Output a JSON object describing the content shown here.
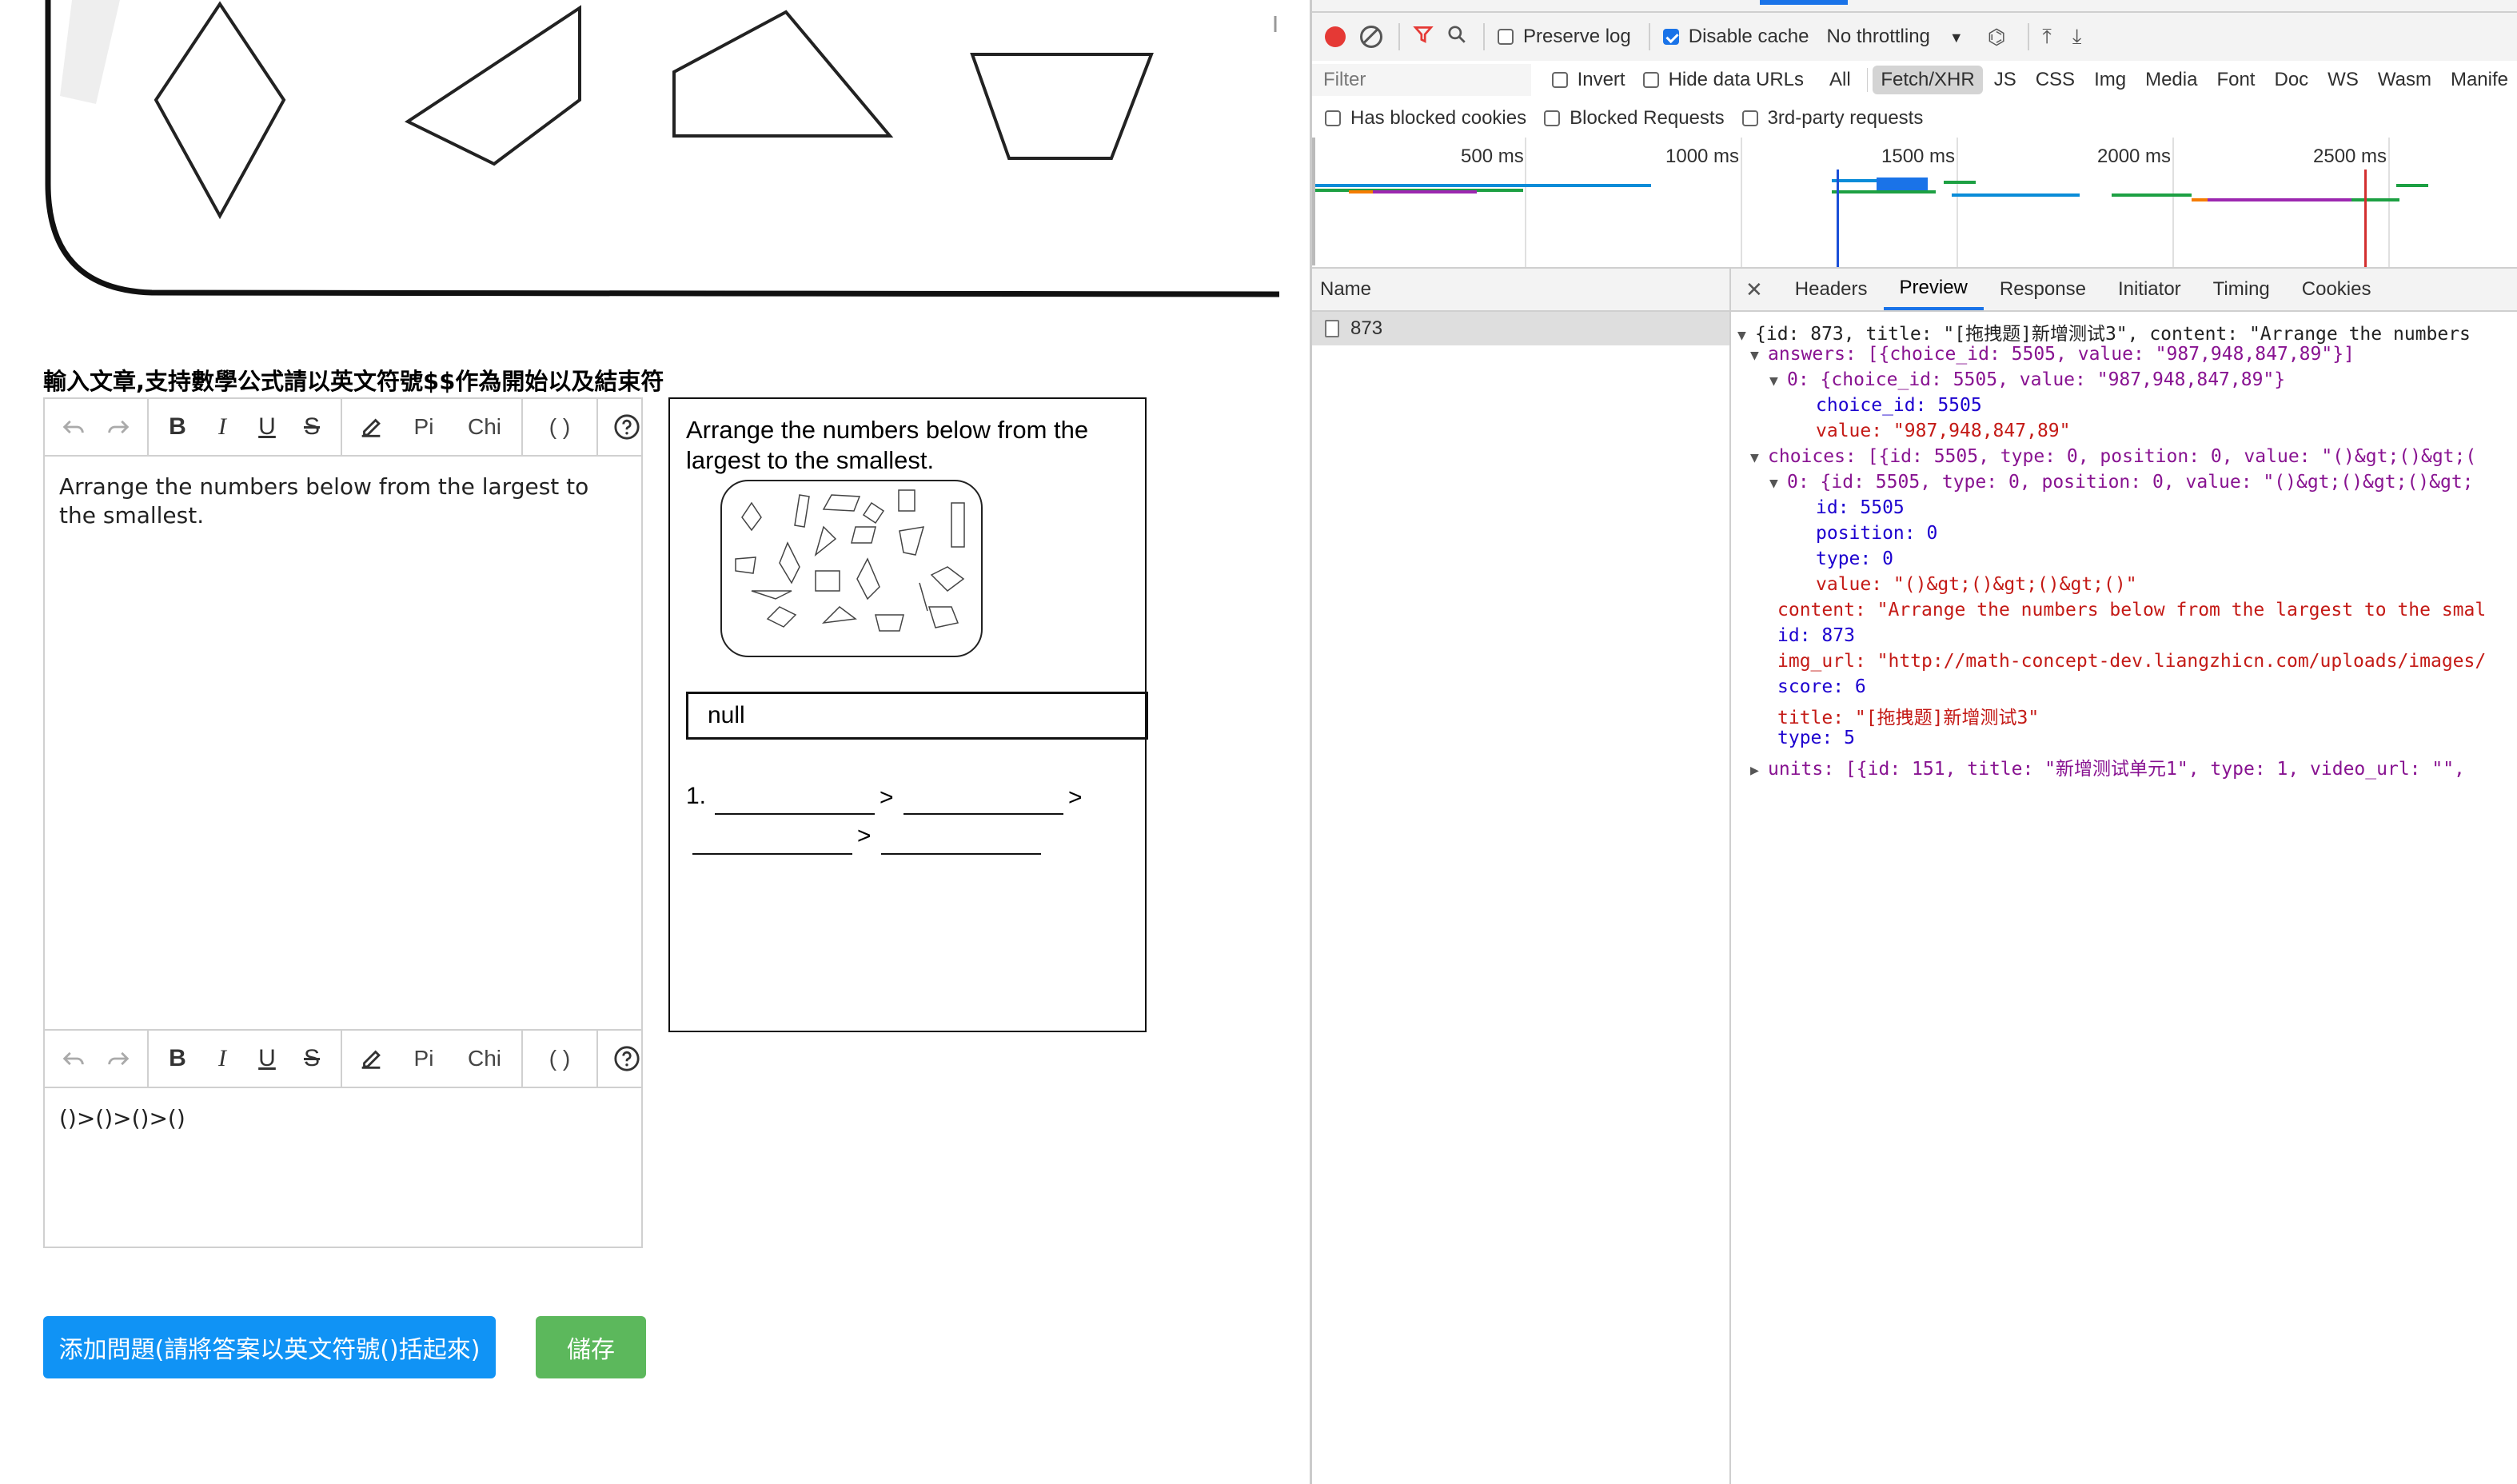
{
  "app": {
    "instruction": "輸入文章,支持數學公式請以英文符號$$作為開始以及結束符",
    "toolbar": {
      "undo": "undo-icon",
      "redo": "redo-icon",
      "bold": "B",
      "italic": "I",
      "underline": "U",
      "strike": "S",
      "pi": "Pi",
      "chi": "Chi",
      "paren": "( )"
    },
    "editor1_text": "Arrange the numbers below from the largest to the smallest.",
    "editor2_text": "()>()>()>()",
    "preview": {
      "question": "Arrange the numbers below from the largest to the smallest.",
      "answer_box": "null",
      "item_number": "1.",
      "gt": ">"
    },
    "add_button": "添加問題(請將答案以英文符號()括起來)",
    "save_button": "儲存",
    "colors": {
      "add": "#1093f5",
      "save": "#5cb85c"
    }
  },
  "devtools": {
    "toolbar": {
      "preserve_log": "Preserve log",
      "disable_cache": "Disable cache",
      "throttling": "No throttling"
    },
    "filter_placeholder": "Filter",
    "invert": "Invert",
    "hide_data_urls": "Hide data URLs",
    "types": [
      "All",
      "Fetch/XHR",
      "JS",
      "CSS",
      "Img",
      "Media",
      "Font",
      "Doc",
      "WS",
      "Wasm",
      "Manife"
    ],
    "selected_type": "Fetch/XHR",
    "blocked_cookies": "Has blocked cookies",
    "blocked_requests": "Blocked Requests",
    "third_party": "3rd-party requests",
    "timeline_ticks": [
      "500 ms",
      "1000 ms",
      "1500 ms",
      "2000 ms",
      "2500 ms"
    ],
    "name_header": "Name",
    "request_name": "873",
    "detail_tabs": [
      "Headers",
      "Preview",
      "Response",
      "Initiator",
      "Timing",
      "Cookies"
    ],
    "active_tab": "Preview",
    "preview_lines": [
      "{id: 873, title: \"[拖拽题]新增测试3\", content: \"Arrange the numbers",
      "answers: [{choice_id: 5505, value: \"987,948,847,89\"}]",
      "0: {choice_id: 5505, value: \"987,948,847,89\"}",
      "choice_id: 5505",
      "value: \"987,948,847,89\"",
      "choices: [{id: 5505, type: 0, position: 0, value: \"()&gt;()&gt;(",
      "0: {id: 5505, type: 0, position: 0, value: \"()&gt;()&gt;()&gt;",
      "id: 5505",
      "position: 0",
      "type: 0",
      "value: \"()&gt;()&gt;()&gt;()\"",
      "content: \"Arrange the numbers below from the largest to the smal",
      "id: 873",
      "img_url: \"http://math-concept-dev.liangzhicn.com/uploads/images/",
      "score: 6",
      "title: \"[拖拽题]新增测试3\"",
      "type: 5",
      "units: [{id: 151, title: \"新增测试单元1\", type: 1, video_url: \"\","
    ]
  }
}
